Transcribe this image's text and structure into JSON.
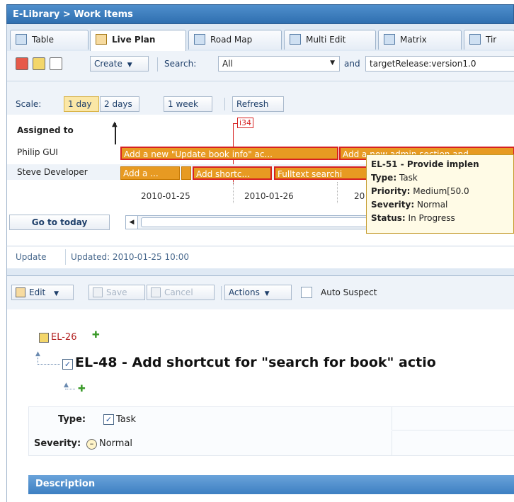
{
  "title": "E-Library > Work Items",
  "tabs": [
    {
      "label": "Table",
      "icon": "table-icon"
    },
    {
      "label": "Live Plan",
      "icon": "live-plan-icon",
      "active": true
    },
    {
      "label": "Road Map",
      "icon": "road-map-icon"
    },
    {
      "label": "Multi Edit",
      "icon": "multi-edit-icon"
    },
    {
      "label": "Matrix",
      "icon": "matrix-icon"
    },
    {
      "label": "Tir",
      "icon": "timeline-icon"
    }
  ],
  "toolbar": {
    "create_label": "Create",
    "search_label": "Search:",
    "search_scope": "All",
    "and_label": "and",
    "query_value": "targetRelease:version1.0"
  },
  "scale": {
    "label": "Scale:",
    "options": [
      "1 day",
      "2 days",
      "1 week"
    ],
    "selected": "1 day",
    "refresh_label": "Refresh"
  },
  "gantt": {
    "header": "Assigned to",
    "marker_label": "i34",
    "rows": [
      {
        "name": "Philip GUI",
        "bars": [
          "Add a new \"Update book info\" ac...",
          "Add a new admin section and"
        ]
      },
      {
        "name": "Steve Developer",
        "bars": [
          "Add a ...",
          "",
          "Add shortc...",
          "Fulltext searchi"
        ]
      }
    ],
    "dates": [
      "2010-01-25",
      "2010-01-26",
      "20"
    ],
    "go_today_label": "Go to today"
  },
  "tooltip": {
    "title": "EL-51 - Provide implen",
    "type_label": "Type:",
    "type_value": "Task",
    "priority_label": "Priority:",
    "priority_value": "Medium[50.0",
    "severity_label": "Severity:",
    "severity_value": "Normal",
    "status_label": "Status:",
    "status_value": "In Progress"
  },
  "status": {
    "update_label": "Update",
    "updated_text": "Updated: 2010-01-25 10:00"
  },
  "editbar": {
    "edit_label": "Edit",
    "save_label": "Save",
    "cancel_label": "Cancel",
    "actions_label": "Actions",
    "auto_suspect_label": "Auto Suspect"
  },
  "detail": {
    "parent_id": "EL-26",
    "item_title": "EL-48 - Add shortcut for \"search for book\" actio",
    "type_label": "Type:",
    "type_value": "Task",
    "severity_label": "Severity:",
    "severity_value": "Normal",
    "description_label": "Description"
  },
  "colors": {
    "accent": "#2f6fb0",
    "bar": "#e79a22",
    "selected_border": "#d62121",
    "tooltip_bg": "#fffbe6"
  }
}
